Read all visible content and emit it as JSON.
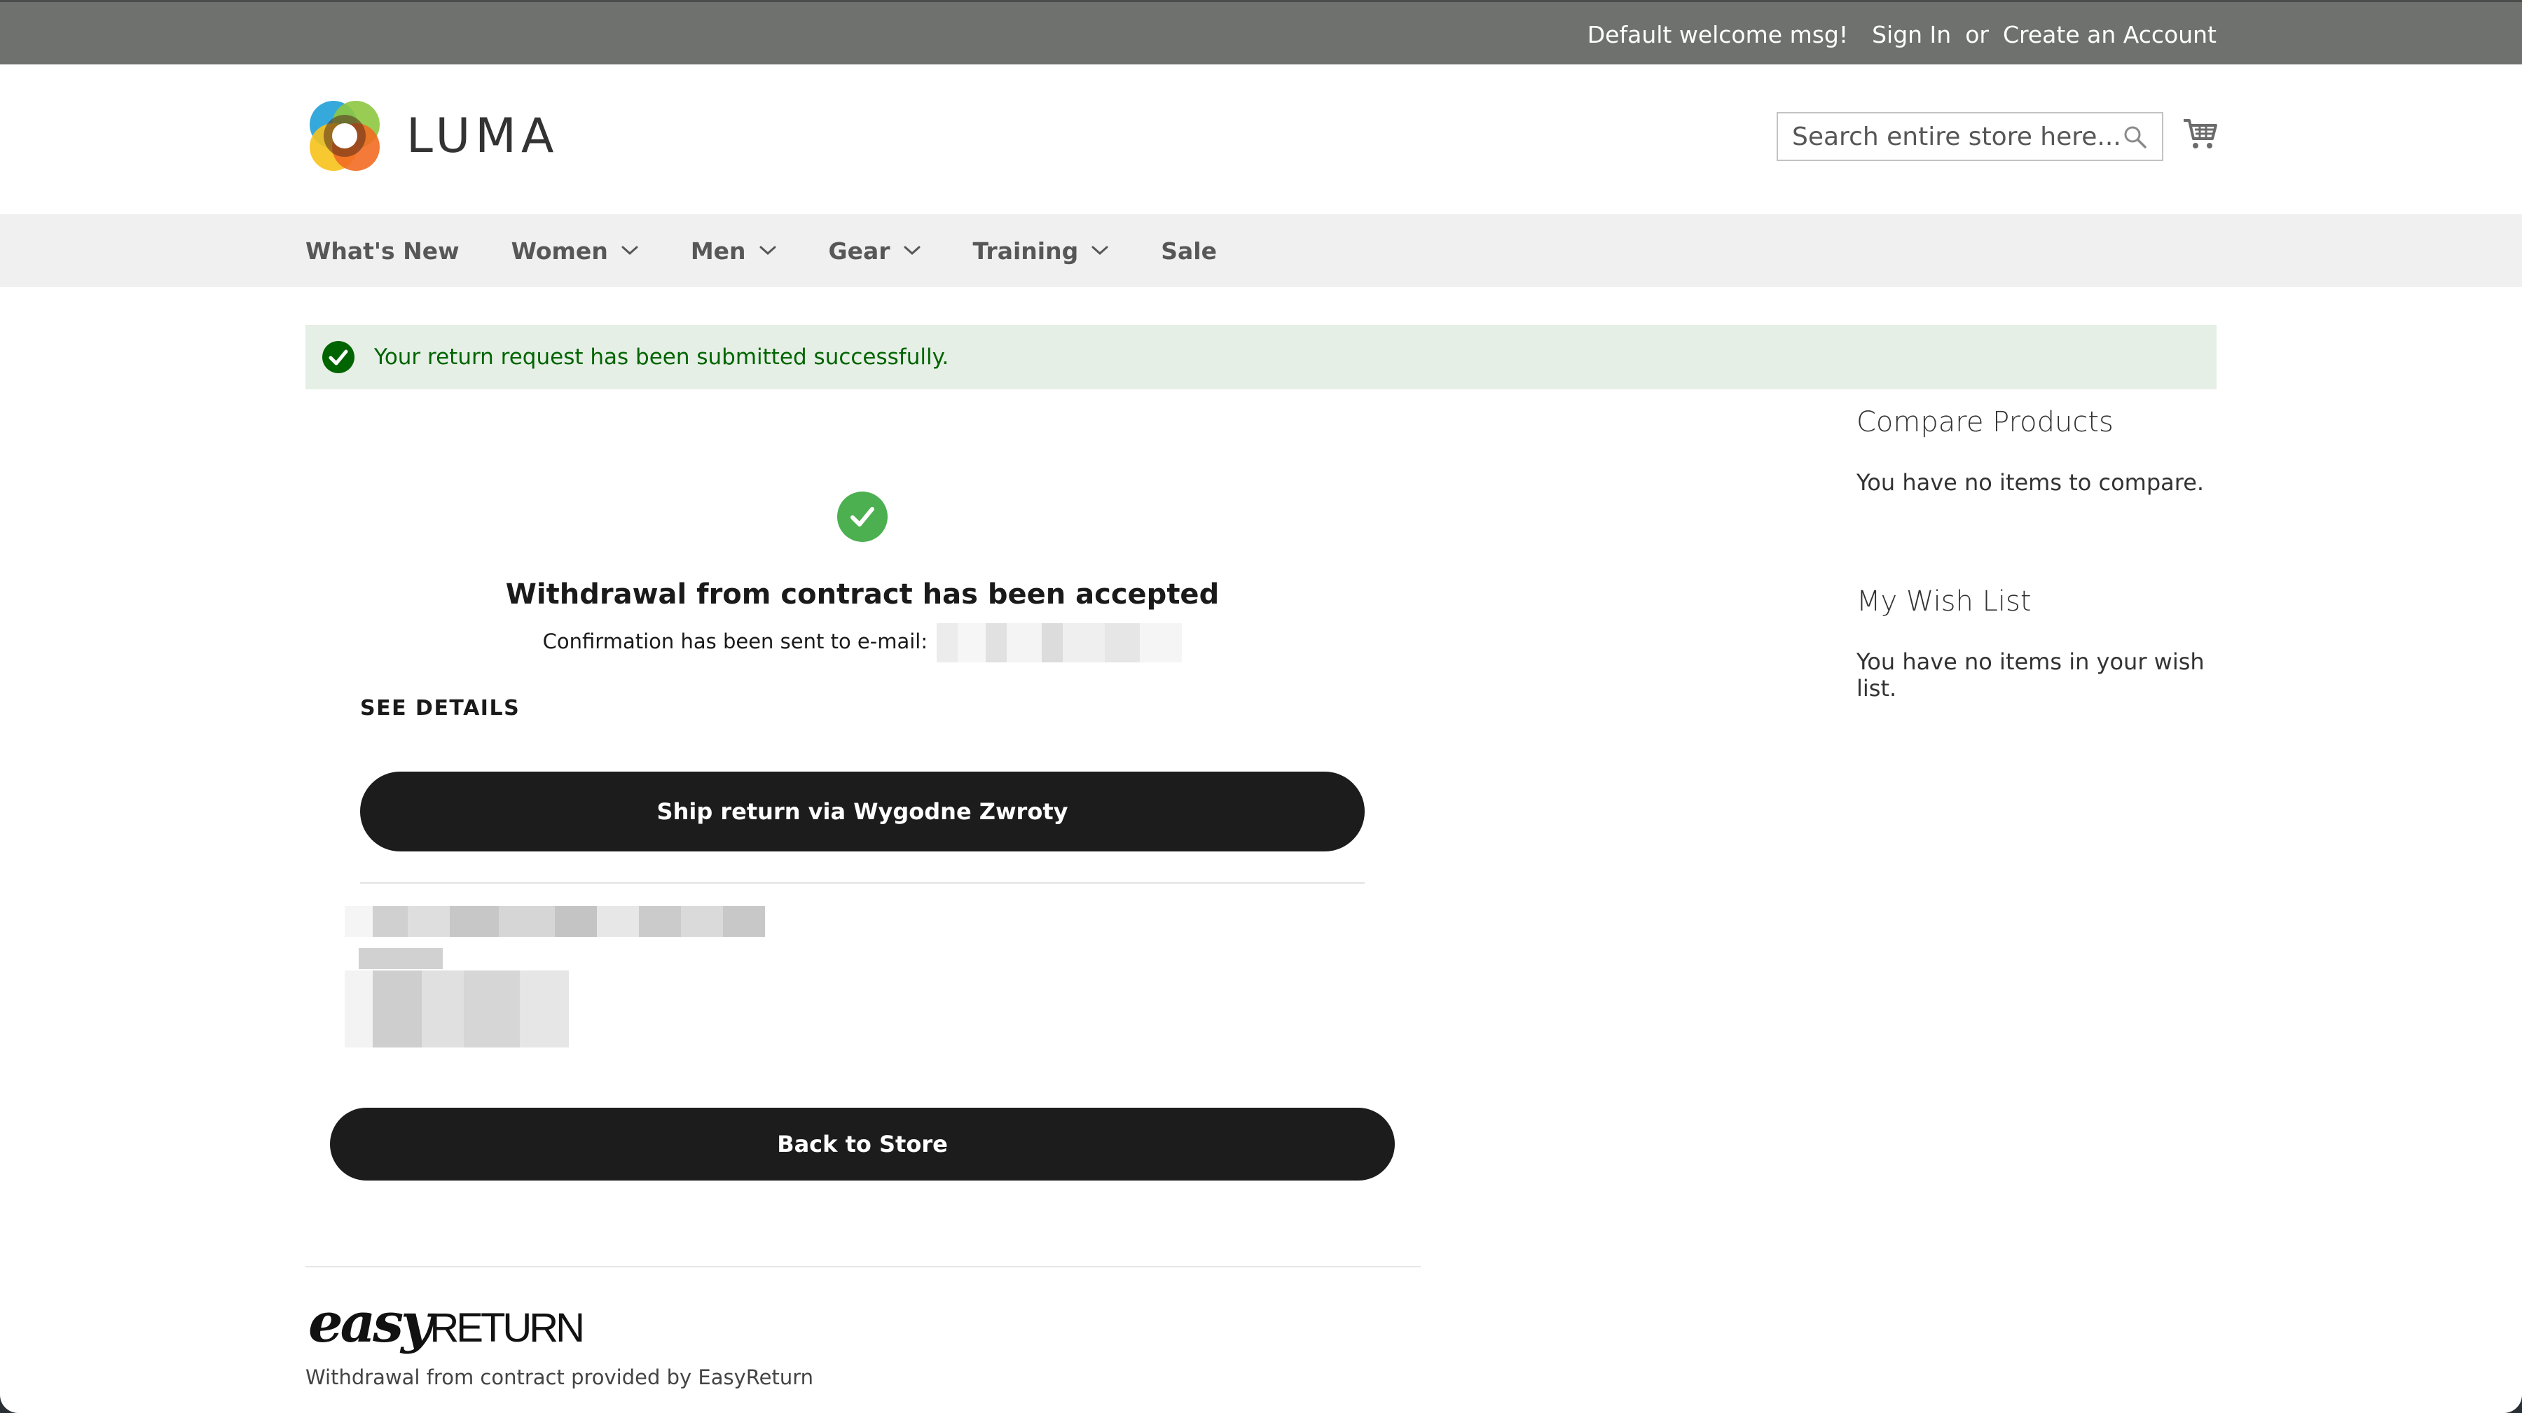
{
  "topbar": {
    "welcome": "Default welcome msg!",
    "sign_in": "Sign In",
    "or": "or",
    "create_account": "Create an Account"
  },
  "header": {
    "logo_text": "LUMA",
    "search_placeholder": "Search entire store here..."
  },
  "nav": {
    "items": [
      {
        "label": "What's New",
        "dropdown": false
      },
      {
        "label": "Women",
        "dropdown": true
      },
      {
        "label": "Men",
        "dropdown": true
      },
      {
        "label": "Gear",
        "dropdown": true
      },
      {
        "label": "Training",
        "dropdown": true
      },
      {
        "label": "Sale",
        "dropdown": false
      }
    ]
  },
  "message": {
    "text": "Your return request has been submitted successfully."
  },
  "main": {
    "title": "Withdrawal from contract has been accepted",
    "confirm_label": "Confirmation has been sent to e-mail:",
    "see_details": "SEE DETAILS",
    "ship_button": "Ship return via Wygodne Zwroty",
    "back_button": "Back to Store",
    "provider_logo_easy": "easy",
    "provider_logo_return": "RETURN",
    "provided_by": "Withdrawal from contract provided by EasyReturn"
  },
  "sidebar": {
    "compare_title": "Compare Products",
    "compare_text": "You have no items to compare.",
    "wishlist_title": "My Wish List",
    "wishlist_text": "You have no items in your wish list."
  },
  "colors": {
    "topbar_bg": "#6e716e",
    "nav_bg": "#f0f0f0",
    "success_bg": "#e5efe5",
    "success_text": "#006400",
    "check_green": "#4caf50",
    "button_bg": "#1c1c1c"
  }
}
